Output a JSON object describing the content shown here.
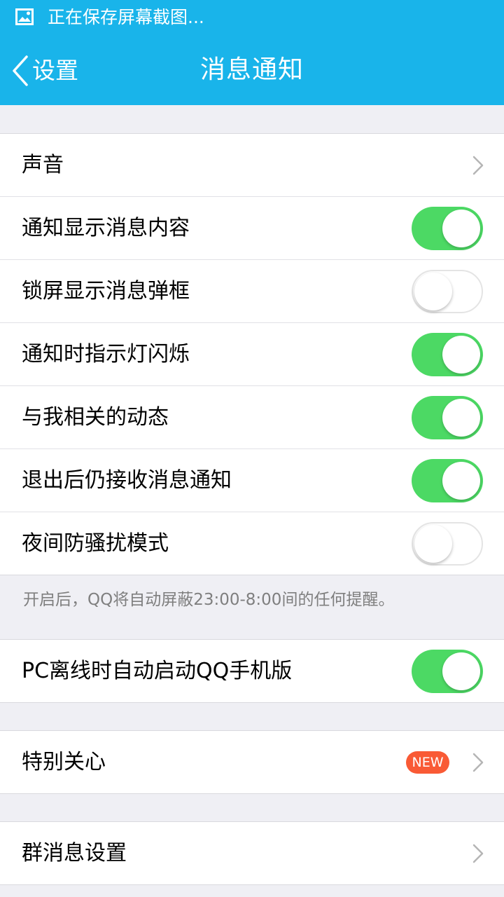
{
  "status_bar": {
    "icon": "image-icon",
    "text": "正在保存屏幕截图..."
  },
  "nav": {
    "back_label": "设置",
    "title": "消息通知"
  },
  "groups": [
    {
      "items": [
        {
          "label": "声音",
          "control": "chevron"
        },
        {
          "label": "通知显示消息内容",
          "control": "toggle",
          "on": true
        },
        {
          "label": "锁屏显示消息弹框",
          "control": "toggle",
          "on": false
        },
        {
          "label": "通知时指示灯闪烁",
          "control": "toggle",
          "on": true
        },
        {
          "label": "与我相关的动态",
          "control": "toggle",
          "on": true
        },
        {
          "label": "退出后仍接收消息通知",
          "control": "toggle",
          "on": true
        },
        {
          "label": "夜间防骚扰模式",
          "control": "toggle",
          "on": false
        }
      ]
    },
    {
      "items": [
        {
          "label": "PC离线时自动启动QQ手机版",
          "control": "toggle",
          "on": true
        }
      ]
    },
    {
      "items": [
        {
          "label": "特别关心",
          "control": "chevron",
          "badge": "NEW"
        }
      ]
    },
    {
      "items": [
        {
          "label": "群消息设置",
          "control": "chevron"
        }
      ]
    }
  ],
  "night_mode_note": "开启后，QQ将自动屏蔽23:00-8:00间的任何提醒。",
  "colors": {
    "header": "#19b4ea",
    "toggle_on": "#4cd964",
    "badge": "#f95a35",
    "background": "#efeff4"
  }
}
